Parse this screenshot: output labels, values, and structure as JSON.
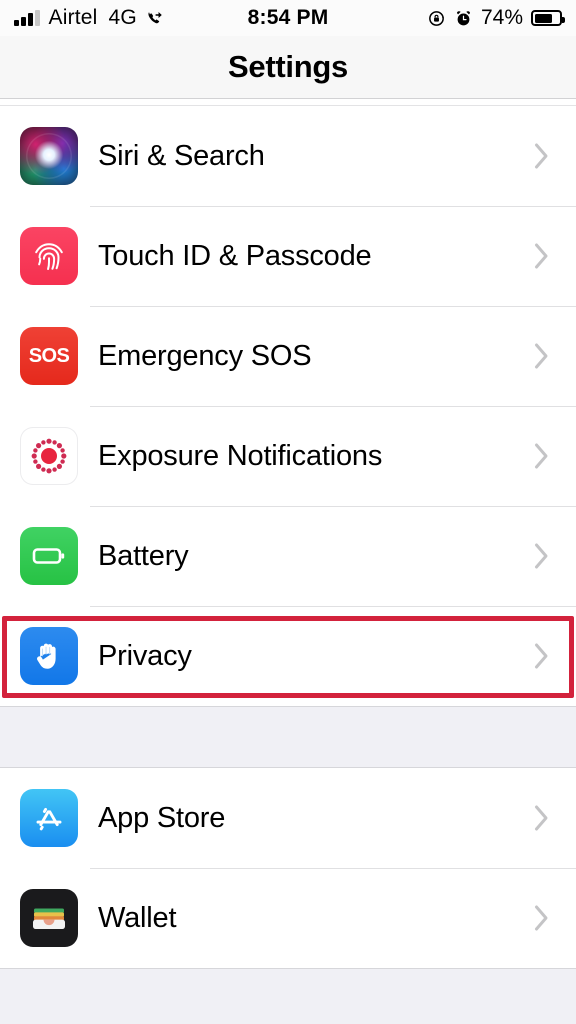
{
  "status_bar": {
    "carrier": "Airtel",
    "network_type": "4G",
    "call_forwarding_icon": "call-forwarding-icon",
    "signal_icon": "cellular-signal-icon",
    "time": "8:54 PM",
    "rotation_lock_icon": "rotation-lock-icon",
    "alarm_icon": "alarm-clock-icon",
    "battery_percent": "74%",
    "battery_level": 74,
    "battery_icon": "battery-icon"
  },
  "navbar": {
    "title": "Settings"
  },
  "groups": [
    {
      "id": "system-group",
      "rows": [
        {
          "id": "siri-and-search",
          "label": "Siri & Search",
          "icon": "siri-icon",
          "chevron": "chevron-right-icon"
        },
        {
          "id": "touch-id-and-passcode",
          "label": "Touch ID & Passcode",
          "icon": "fingerprint-icon",
          "chevron": "chevron-right-icon"
        },
        {
          "id": "emergency-sos",
          "label": "Emergency SOS",
          "icon": "sos-icon",
          "icon_text": "SOS",
          "chevron": "chevron-right-icon"
        },
        {
          "id": "exposure-notifications",
          "label": "Exposure Notifications",
          "icon": "exposure-notifications-icon",
          "chevron": "chevron-right-icon"
        },
        {
          "id": "battery",
          "label": "Battery",
          "icon": "battery-app-icon",
          "chevron": "chevron-right-icon"
        },
        {
          "id": "privacy",
          "label": "Privacy",
          "icon": "privacy-hand-icon",
          "chevron": "chevron-right-icon",
          "highlighted": true
        }
      ]
    },
    {
      "id": "store-group",
      "rows": [
        {
          "id": "app-store",
          "label": "App Store",
          "icon": "app-store-icon",
          "chevron": "chevron-right-icon"
        },
        {
          "id": "wallet",
          "label": "Wallet",
          "icon": "wallet-icon",
          "chevron": "chevron-right-icon"
        }
      ]
    }
  ],
  "highlight": {
    "target": "privacy",
    "color": "#d3223c",
    "style": "rectangle-outline"
  },
  "colors": {
    "page_background": "#ffffff",
    "group_gap": "#f0f0f5",
    "navbar_background": "#f7f7f7",
    "divider": "#e0e0e2",
    "label_text": "#000000",
    "chevron": "#c4c4c6",
    "highlight": "#d3223c"
  }
}
